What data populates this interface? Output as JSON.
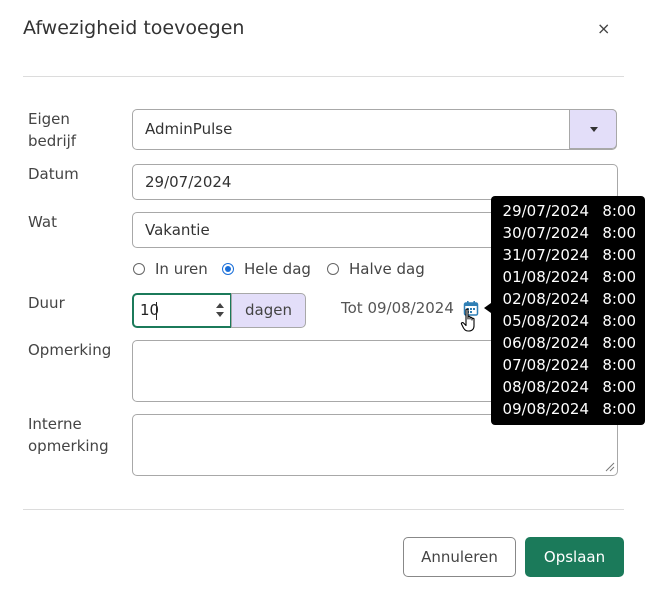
{
  "dialog": {
    "title": "Afwezigheid toevoegen",
    "close_glyph": "×"
  },
  "form": {
    "company": {
      "label": "Eigen bedrijf",
      "value": "AdminPulse"
    },
    "date": {
      "label": "Datum",
      "value": "29/07/2024"
    },
    "what": {
      "label": "Wat",
      "value": "Vakantie"
    },
    "mode": {
      "options": [
        "In uren",
        "Hele dag",
        "Halve dag"
      ],
      "selected": "Hele dag"
    },
    "duration": {
      "label": "Duur",
      "value": "10",
      "unit": "dagen",
      "until": "Tot 09/08/2024"
    },
    "remark": {
      "label": "Opmerking",
      "value": ""
    },
    "internal_remark": {
      "label": "Interne opmerking",
      "value": ""
    }
  },
  "tooltip": {
    "rows": [
      {
        "date": "29/07/2024",
        "hours": "8:00"
      },
      {
        "date": "30/07/2024",
        "hours": "8:00"
      },
      {
        "date": "31/07/2024",
        "hours": "8:00"
      },
      {
        "date": "01/08/2024",
        "hours": "8:00"
      },
      {
        "date": "02/08/2024",
        "hours": "8:00"
      },
      {
        "date": "05/08/2024",
        "hours": "8:00"
      },
      {
        "date": "06/08/2024",
        "hours": "8:00"
      },
      {
        "date": "07/08/2024",
        "hours": "8:00"
      },
      {
        "date": "08/08/2024",
        "hours": "8:00"
      },
      {
        "date": "09/08/2024",
        "hours": "8:00"
      }
    ]
  },
  "footer": {
    "cancel_label": "Annuleren",
    "save_label": "Opslaan"
  },
  "colors": {
    "primary": "#1b7a5a",
    "addon_bg": "#e3def9",
    "radio_accent": "#1a6fd9",
    "calendar_icon": "#2f7fb5"
  },
  "icons": {
    "close": "close-icon",
    "dropdown": "chevron-down-icon",
    "calendar": "calendar-icon",
    "cursor": "hand-pointer-icon"
  }
}
